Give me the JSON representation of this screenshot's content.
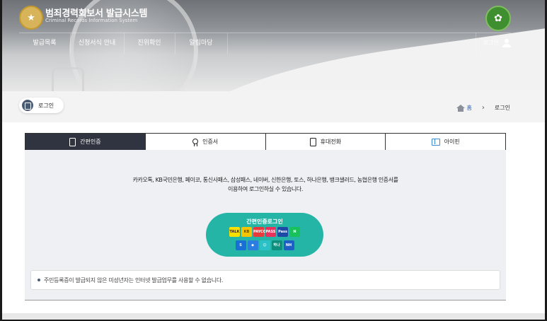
{
  "header": {
    "title": "범죄경력회보서 발급시스템",
    "subtitle": "Criminal Records Information System",
    "logo_icon": "police-emblem-icon",
    "badge_icon": "green-mascot-badge-icon"
  },
  "nav": {
    "items": [
      "발급목록",
      "신청서식 안내",
      "진위확인",
      "알림마당"
    ],
    "login_label": "로그인"
  },
  "breadcrumb": {
    "page_label": "로그인",
    "home_label": "홈",
    "current": "로그인"
  },
  "tabs": [
    {
      "label": "간편인증",
      "icon": "phone-icon",
      "active": true
    },
    {
      "label": "인증서",
      "icon": "certificate-icon",
      "active": false
    },
    {
      "label": "휴대전화",
      "icon": "mobile-phone-icon",
      "active": false
    },
    {
      "label": "아이핀",
      "icon": "ipin-icon",
      "active": false
    }
  ],
  "content": {
    "desc_line1": "카카오톡, KB국민은행, 페이코, 통신사패스, 삼성패스, 네이버, 신한은행, 토스, 하나은행, 뱅크샐러드, 농협은행 인증서를",
    "desc_line2": "이용하여 로그인하실 수 있습니다.",
    "simple_login_label": "간편인증로그인",
    "providers_row1": [
      {
        "label": "TALK",
        "bg": "#f9e000",
        "fg": "#3c1e1e"
      },
      {
        "label": "KB",
        "bg": "#f5c400",
        "fg": "#5a4a00"
      },
      {
        "label": "PAYCO",
        "bg": "#e83a3a",
        "fg": "#ffffff"
      },
      {
        "label": "PASS",
        "bg": "#e8315d",
        "fg": "#ffffff"
      },
      {
        "label": "Pass",
        "bg": "#1e4aa6",
        "fg": "#ffffff"
      },
      {
        "label": "N",
        "bg": "#19c15a",
        "fg": "#ffffff"
      }
    ],
    "providers_row2": [
      {
        "label": "S",
        "bg": "#1a6fd6",
        "fg": "#ffffff"
      },
      {
        "label": "◆",
        "bg": "#2b7de0",
        "fg": "#ffffff"
      },
      {
        "label": "☺",
        "bg": "#2ac1c8",
        "fg": "#ffffff"
      },
      {
        "label": "하나",
        "bg": "#0e8f7e",
        "fg": "#ffffff"
      },
      {
        "label": "NH",
        "bg": "#1f5fc5",
        "fg": "#ffffff"
      }
    ],
    "notice": "주민등록증이 발급되지 않은 미성년자는 인터넷 발급업무를 사용할 수 없습니다."
  },
  "colors": {
    "accent": "#24b5a7",
    "active_tab": "#2f3440",
    "home_link": "#2b63b8"
  }
}
